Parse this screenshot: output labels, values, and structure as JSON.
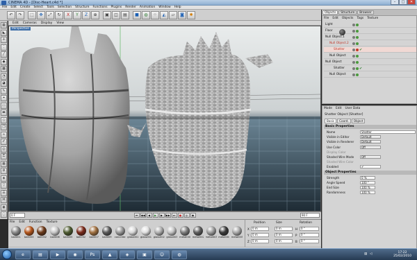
{
  "window": {
    "title": "CINEMA 4D - [Disc-Heart.c4d *]",
    "min": "–",
    "max": "□",
    "close": "✕"
  },
  "menubar": [
    "File",
    "Edit",
    "Create",
    "Select",
    "Tools",
    "Selection",
    "Structure",
    "Functions",
    "Plugins",
    "Render",
    "Animation",
    "Window",
    "Help"
  ],
  "toolbar_icons": [
    "undo-icon",
    "redo-icon",
    "live-selection-icon",
    "move-icon",
    "scale-icon",
    "rotate-icon",
    "x-axis-icon",
    "y-axis-icon",
    "z-axis-icon",
    "coordinate-system-icon",
    "render-view-icon",
    "render-region-icon",
    "render-picture-viewer-icon",
    "cube-icon",
    "hypernurbs-icon",
    "array-icon",
    "deformer-icon",
    "floor-icon",
    "camera-icon",
    "light-icon"
  ],
  "viewport": {
    "menu": [
      "Edit",
      "Cameras",
      "Display",
      "View"
    ],
    "label": "Perspective"
  },
  "timeline": {
    "start_frame": "0 F",
    "end_frame": "90 F"
  },
  "materials": {
    "menu": [
      "File",
      "Edit",
      "Function",
      "Texture"
    ],
    "items": [
      {
        "name": "ball001",
        "color": "#8a8a8a"
      },
      {
        "name": "ball003",
        "color": "#b4561c"
      },
      {
        "name": "ball002",
        "color": "#6c3a1a"
      },
      {
        "name": "ball006",
        "color": "#c8c8c8"
      },
      {
        "name": "ball005",
        "color": "#4d5a30"
      },
      {
        "name": "ball002",
        "color": "#7a2a1a"
      },
      {
        "name": "ball007",
        "color": "#a07040"
      },
      {
        "name": "ball009",
        "color": "#5a5a5a"
      },
      {
        "name": "concrete",
        "color": "#9a9a9a"
      },
      {
        "name": "glass001",
        "color": "#d8d8d8"
      },
      {
        "name": "glass001",
        "color": "#e0e0e0"
      },
      {
        "name": "glass002",
        "color": "#b0b0b0"
      },
      {
        "name": "glass003",
        "color": "#c4c4c4"
      },
      {
        "name": "metal000",
        "color": "#7c7c7c"
      },
      {
        "name": "metal002",
        "color": "#5e5e5e"
      },
      {
        "name": "metal003",
        "color": "#9e9e9e"
      },
      {
        "name": "metal004",
        "color": "#3a3a3a"
      },
      {
        "name": "metal005",
        "color": "#aaaaaa"
      }
    ]
  },
  "coordinates": {
    "headers": [
      "Position",
      "Size",
      "Rotation"
    ],
    "rows": [
      {
        "axis": "X",
        "pos": "0 m",
        "size": "0 m",
        "rot_axis": "H",
        "rot": "0 °"
      },
      {
        "axis": "Y",
        "pos": "0 m",
        "size": "0 m",
        "rot_axis": "P",
        "rot": "0 °"
      },
      {
        "axis": "Z",
        "pos": "0 m",
        "size": "0 m",
        "rot_axis": "B",
        "rot": "0 °"
      }
    ],
    "mode_select": "Object",
    "size_select": "Size",
    "apply_label": "Apply"
  },
  "right_tabs": [
    "Objects",
    "Structure",
    "Browser"
  ],
  "object_manager": {
    "menu": [
      "File",
      "Edit",
      "Objects",
      "Tags",
      "Texture"
    ],
    "rows": [
      {
        "name": "Light",
        "indent": 0,
        "flag": "g",
        "selected": false,
        "red": false,
        "check": ""
      },
      {
        "name": "Floor",
        "indent": 0,
        "flag": "g",
        "selected": false,
        "red": false,
        "check": ""
      },
      {
        "name": "Null Object.1",
        "indent": 0,
        "flag": "g",
        "selected": false,
        "red": false,
        "check": ""
      },
      {
        "name": "Null Object.2",
        "indent": 1,
        "flag": "g",
        "selected": false,
        "red": true,
        "check": ""
      },
      {
        "name": "Shatter",
        "indent": 2,
        "flag": "r",
        "selected": true,
        "red": true,
        "check": "✔"
      },
      {
        "name": "Null Object",
        "indent": 1,
        "flag": "g",
        "selected": false,
        "red": false,
        "check": ""
      },
      {
        "name": "Null Object",
        "indent": 0,
        "flag": "g",
        "selected": false,
        "red": false,
        "check": ""
      },
      {
        "name": "Shatter",
        "indent": 2,
        "flag": "g",
        "selected": false,
        "red": false,
        "check": "✔"
      },
      {
        "name": "Null Object",
        "indent": 1,
        "flag": "g",
        "selected": false,
        "red": false,
        "check": ""
      }
    ]
  },
  "attributes": {
    "menu": [
      "Mode",
      "Edit",
      "User Data"
    ],
    "title": "Shatter Object [Shatter]",
    "tabs": [
      "Basic",
      "Coord.",
      "Object"
    ],
    "basic_header": "Basic Properties",
    "basic": [
      {
        "label": "Name",
        "value": "Shatter",
        "wide": true,
        "drop": false,
        "gray": false
      },
      {
        "label": "Visible in Editor",
        "value": "Default",
        "wide": false,
        "drop": true,
        "gray": false
      },
      {
        "label": "Visible in Renderer",
        "value": "Default",
        "wide": false,
        "drop": true,
        "gray": false
      },
      {
        "label": "Use Color",
        "value": "Off",
        "wide": false,
        "drop": true,
        "gray": false
      },
      {
        "label": "Display Color",
        "value": "",
        "wide": false,
        "drop": false,
        "gray": true
      },
      {
        "label": "Shaded Wire Mode",
        "value": "Off",
        "wide": false,
        "drop": true,
        "gray": false
      },
      {
        "label": "Shaded Wire Color",
        "value": "",
        "wide": false,
        "drop": false,
        "gray": true
      },
      {
        "label": "Enabled",
        "value": "✔",
        "wide": false,
        "drop": false,
        "gray": false
      }
    ],
    "object_header": "Object Properties",
    "object": [
      {
        "label": "Strength",
        "value": "0 %"
      },
      {
        "label": "Angle Speed",
        "value": "100 °"
      },
      {
        "label": "End Size",
        "value": "100 %"
      },
      {
        "label": "Randomness",
        "value": "100 %"
      }
    ]
  },
  "status": "Move: Click and drag to move elements. Hold down SHIFT to quantize movement / add to the selection in point mode. CTRL to remove.",
  "taskbar": {
    "apps": [
      "ie-icon",
      "explorer-icon",
      "media-player-icon",
      "cinema4d-icon",
      "photoshop-icon",
      "vlc-icon",
      "network-icon",
      "folder-icon",
      "messenger-icon",
      "firefox-icon"
    ],
    "glyphs": [
      "e",
      "▤",
      "▶",
      "◉",
      "Ps",
      "▲",
      "◈",
      "▣",
      "☺",
      "◍"
    ],
    "time": "17:22",
    "date": "25/02/2010"
  }
}
